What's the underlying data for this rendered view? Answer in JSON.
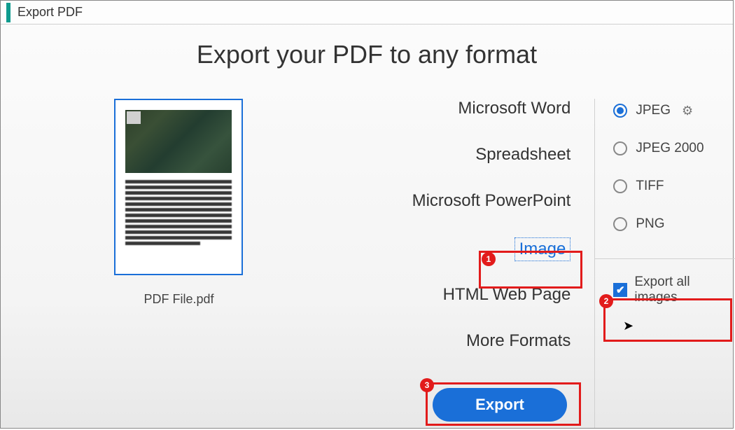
{
  "title": "Export PDF",
  "heading": "Export your PDF to any format",
  "file": {
    "name": "PDF File.pdf"
  },
  "formats": {
    "word": "Microsoft Word",
    "spreadsheet": "Spreadsheet",
    "powerpoint": "Microsoft PowerPoint",
    "image": "Image",
    "html": "HTML Web Page",
    "more": "More Formats"
  },
  "image_options": {
    "jpeg": "JPEG",
    "jpeg2000": "JPEG 2000",
    "tiff": "TIFF",
    "png": "PNG",
    "export_all": "Export all images"
  },
  "export_label": "Export",
  "callouts": {
    "c1": "1",
    "c2": "2",
    "c3": "3"
  }
}
